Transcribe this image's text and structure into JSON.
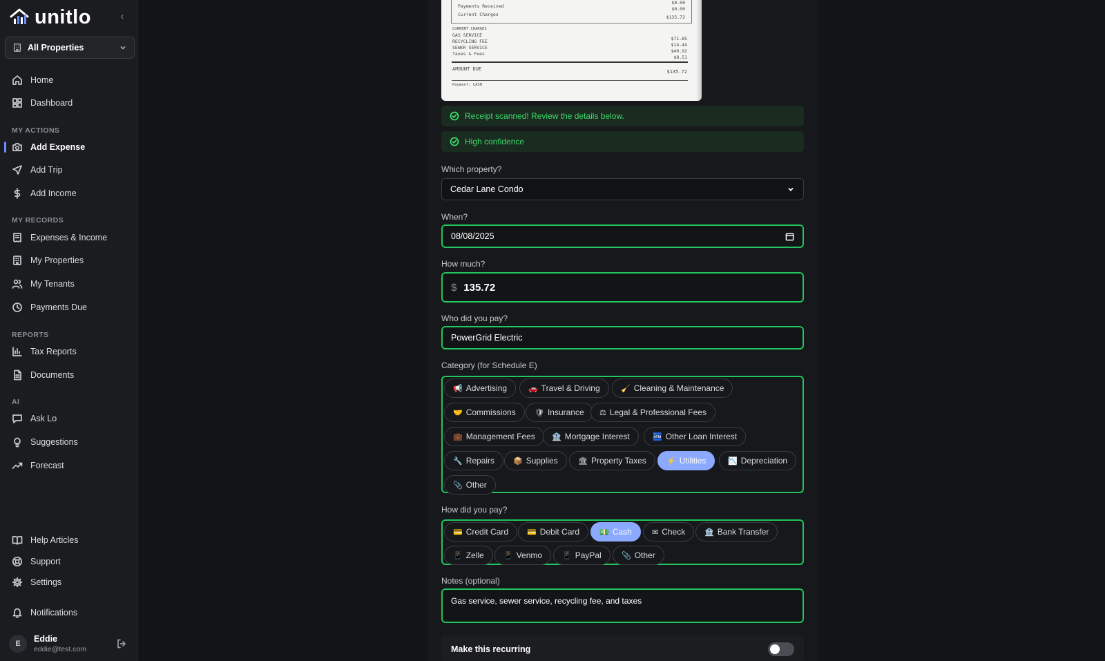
{
  "app": {
    "name": "unitlo"
  },
  "property_selector": {
    "label": "All Properties"
  },
  "nav": {
    "top": [
      {
        "label": "Home",
        "icon": "home-icon"
      },
      {
        "label": "Dashboard",
        "icon": "dashboard-icon"
      }
    ],
    "my_actions_label": "MY ACTIONS",
    "my_actions": [
      {
        "label": "Add Expense",
        "icon": "camera-icon"
      },
      {
        "label": "Add Trip",
        "icon": "navigation-icon"
      },
      {
        "label": "Add Income",
        "icon": "dollar-icon"
      }
    ],
    "my_records_label": "MY RECORDS",
    "my_records": [
      {
        "label": "Expenses & Income",
        "icon": "receipt-icon"
      },
      {
        "label": "My Properties",
        "icon": "building-icon"
      },
      {
        "label": "My Tenants",
        "icon": "users-icon"
      },
      {
        "label": "Payments Due",
        "icon": "clock-icon"
      }
    ],
    "reports_label": "REPORTS",
    "reports": [
      {
        "label": "Tax Reports",
        "icon": "bar-chart-icon"
      },
      {
        "label": "Documents",
        "icon": "document-icon"
      }
    ],
    "ai_label": "AI",
    "ai": [
      {
        "label": "Ask Lo",
        "icon": "chat-icon"
      },
      {
        "label": "Suggestions",
        "icon": "lightbulb-icon"
      },
      {
        "label": "Forecast",
        "icon": "trending-icon"
      }
    ],
    "bottom": [
      {
        "label": "Help Articles",
        "icon": "book-icon"
      },
      {
        "label": "Support",
        "icon": "lifebuoy-icon"
      },
      {
        "label": "Settings",
        "icon": "gear-icon"
      },
      {
        "label": "Notifications",
        "icon": "bell-icon"
      }
    ]
  },
  "user": {
    "initial": "E",
    "name": "Eddie",
    "email": "eddie@test.com"
  },
  "receipt": {
    "header_rows": [
      {
        "label": "Payments Received",
        "amount": "$0.00"
      },
      {
        "label": "Current Charges",
        "amount": "$135.72"
      }
    ],
    "top_amount": "$0.00",
    "section": "CURRENT CHARGES",
    "items": [
      {
        "label": "GAS SERVICE",
        "amount": "$71.85"
      },
      {
        "label": "RECYCLING FEE",
        "amount": "$14.44"
      },
      {
        "label": "SEWER SERVICE",
        "amount": "$40.92"
      },
      {
        "label": "Taxes & Fees",
        "amount": "$8.51"
      }
    ],
    "amount_due_label": "AMOUNT DUE",
    "amount_due": "$135.72",
    "payment": "Payment: CASH"
  },
  "banners": {
    "scanned": "Receipt scanned! Review the details below.",
    "confidence": "High confidence"
  },
  "form": {
    "property_label": "Which property?",
    "property_value": "Cedar Lane Condo",
    "date_label": "When?",
    "date_value": "08/08/2025",
    "amount_label": "How much?",
    "currency_symbol": "$",
    "amount_value": "135.72",
    "payee_label": "Who did you pay?",
    "payee_value": "PowerGrid Electric",
    "category_label": "Category (for Schedule E)",
    "categories": [
      {
        "icon": "📢",
        "label": "Advertising"
      },
      {
        "icon": "🚗",
        "label": "Travel & Driving"
      },
      {
        "icon": "🧹",
        "label": "Cleaning & Maintenance"
      },
      {
        "icon": "🤝",
        "label": "Commissions"
      },
      {
        "icon": "🛡",
        "label": "Insurance"
      },
      {
        "icon": "⚖",
        "label": "Legal & Professional Fees"
      },
      {
        "icon": "💼",
        "label": "Management Fees"
      },
      {
        "icon": "🏦",
        "label": "Mortgage Interest"
      },
      {
        "icon": "🏧",
        "label": "Other Loan Interest"
      },
      {
        "icon": "🔧",
        "label": "Repairs"
      },
      {
        "icon": "📦",
        "label": "Supplies"
      },
      {
        "icon": "🏛",
        "label": "Property Taxes"
      },
      {
        "icon": "⚡",
        "label": "Utilities"
      },
      {
        "icon": "📉",
        "label": "Depreciation"
      },
      {
        "icon": "📎",
        "label": "Other"
      }
    ],
    "selected_category": "Utilities",
    "payment_label": "How did you pay?",
    "payment_methods": [
      {
        "icon": "💳",
        "label": "Credit Card"
      },
      {
        "icon": "💳",
        "label": "Debit Card"
      },
      {
        "icon": "💵",
        "label": "Cash"
      },
      {
        "icon": "✉",
        "label": "Check"
      },
      {
        "icon": "🏦",
        "label": "Bank Transfer"
      },
      {
        "icon": "📱",
        "label": "Zelle"
      },
      {
        "icon": "📱",
        "label": "Venmo"
      },
      {
        "icon": "📱",
        "label": "PayPal"
      },
      {
        "icon": "📎",
        "label": "Other"
      }
    ],
    "selected_payment": "Cash",
    "notes_label": "Notes (optional)",
    "notes_value": "Gas service, sewer service, recycling fee, and taxes",
    "recurring_label": "Make this recurring",
    "recurring_on": false
  },
  "colors": {
    "accent": "#8aa9ff",
    "success": "#22c55e",
    "success_text": "#3ddc6e",
    "sidebar_bg": "#1b1c1f",
    "page_bg": "#131416"
  }
}
